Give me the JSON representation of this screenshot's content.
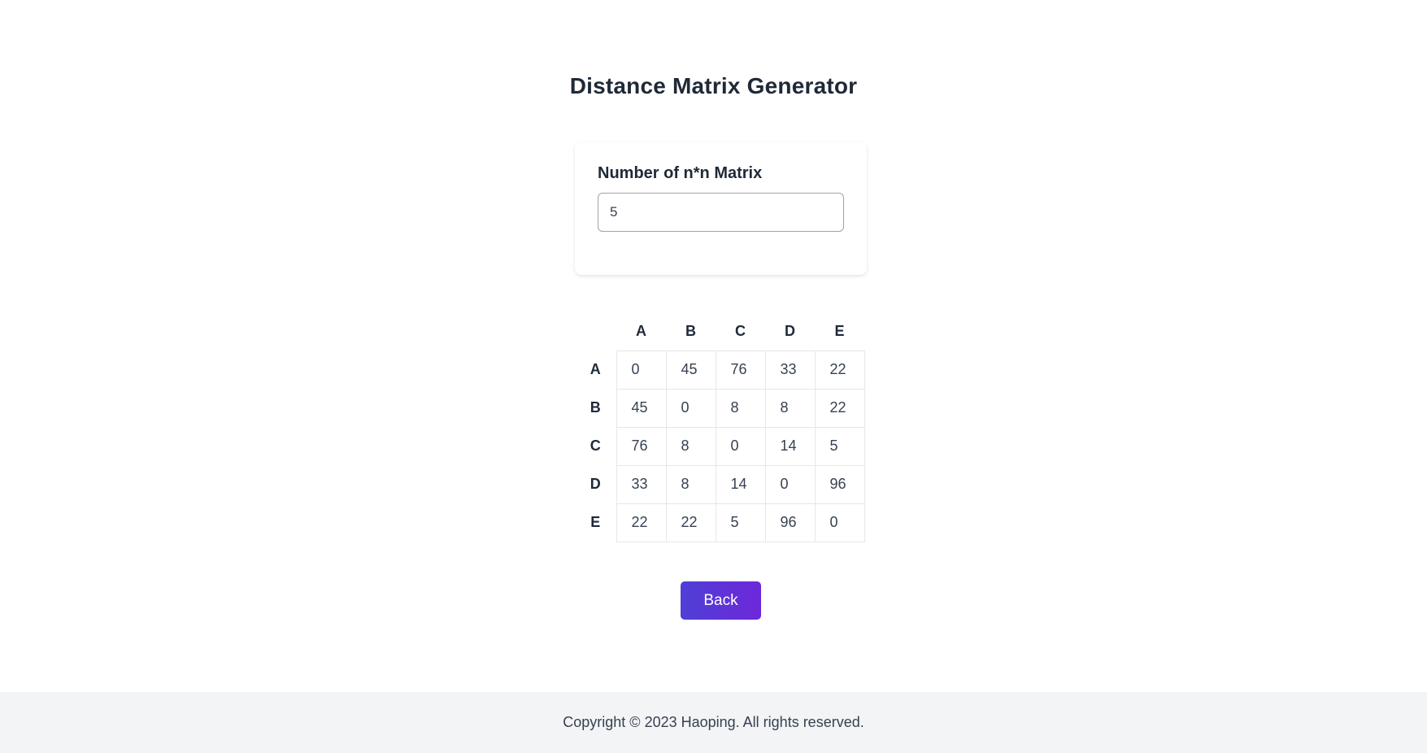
{
  "header": {
    "title": "Distance Matrix Generator"
  },
  "form": {
    "label": "Number of n*n Matrix",
    "input_value": "5"
  },
  "matrix": {
    "headers": [
      "A",
      "B",
      "C",
      "D",
      "E"
    ],
    "rows": [
      {
        "label": "A",
        "cells": [
          "0",
          "45",
          "76",
          "33",
          "22"
        ]
      },
      {
        "label": "B",
        "cells": [
          "45",
          "0",
          "8",
          "8",
          "22"
        ]
      },
      {
        "label": "C",
        "cells": [
          "76",
          "8",
          "0",
          "14",
          "5"
        ]
      },
      {
        "label": "D",
        "cells": [
          "33",
          "8",
          "14",
          "0",
          "96"
        ]
      },
      {
        "label": "E",
        "cells": [
          "22",
          "22",
          "5",
          "96",
          "0"
        ]
      }
    ]
  },
  "actions": {
    "back_label": "Back"
  },
  "footer": {
    "text": "Copyright © 2023 Haoping. All rights reserved."
  },
  "colors": {
    "button_gradient_start": "#4f3fd6",
    "button_gradient_end": "#6d28d9",
    "footer_bg": "#f3f4f6"
  }
}
